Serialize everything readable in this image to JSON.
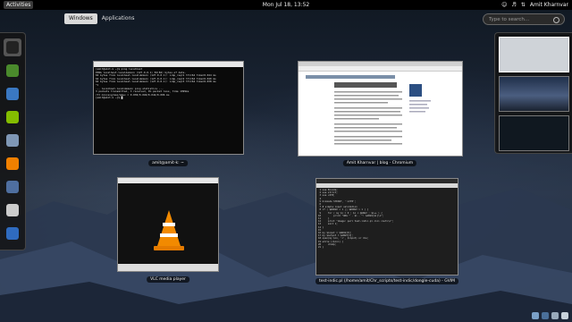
{
  "topbar": {
    "activities": "Activities",
    "clock": "Mon Jul 18, 13:52",
    "user": "Amit Kharnvar"
  },
  "overview": {
    "tabs": [
      "Windows",
      "Applications"
    ],
    "search_placeholder": "Type to search..."
  },
  "dash": {
    "items": [
      {
        "name": "terminal",
        "color": "#222222"
      },
      {
        "name": "gvim",
        "color": "#4a8a2c"
      },
      {
        "name": "chromium",
        "color": "#3a78c2"
      },
      {
        "name": "spotify",
        "color": "#84bd00"
      },
      {
        "name": "text-editor",
        "color": "#7f97b5"
      },
      {
        "name": "vlc",
        "color": "#f08000"
      },
      {
        "name": "system-monitor",
        "color": "#4f6fa0"
      },
      {
        "name": "document",
        "color": "#cccccc"
      },
      {
        "name": "app-grid",
        "color": "#2f6bbf"
      }
    ]
  },
  "windows": {
    "terminal": {
      "caption": "amit@amit-k: ~",
      "lines": [
        "[amit@amit-k ~]$ ping localhost",
        "PING localhost.localdomain (127.0.0.1) 56(84) bytes of data.",
        "64 bytes from localhost.localdomain (127.0.0.1): icmp_req=1 ttl=64 time=0.044 ms",
        "64 bytes from localhost.localdomain (127.0.0.1): icmp_req=2 ttl=64 time=0.040 ms",
        "64 bytes from localhost.localdomain (127.0.0.1): icmp_req=3 ttl=64 time=0.038 ms",
        "^C",
        "--- localhost.localdomain ping statistics ---",
        "3 packets transmitted, 3 received, 0% packet loss, time 1999ms",
        "rtt min/avg/max/mdev = 0.038/0.040/0.044/0.006 ms",
        "[amit@amit-k ~]$ █"
      ]
    },
    "chromium": {
      "caption": "Amit Kharnvar | blog - Chromium"
    },
    "vlc": {
      "caption": "VLC media player"
    },
    "gvim": {
      "caption": "test-indic.pl (/home/amit/Chr_scripts/test-indic/dongle-cuda) - GVIM",
      "lines": [
        " 1 use Encode;",
        " 2 use strict;",
        " 3 use utf8;",
        " 4 ",
        " 5 binmode STDOUT, ':utf8';",
        " 6 ",
        " 7 # simple input validation",
        " 8 if ( $#ARGV < 1 || $#ARGV > 1 ) {",
        " 9     for ( my $i = 0 ; $i < @ARGV ; $i++ ) {",
        "10         print \"ARG \" . $i . \": $ARGV[$i]\\n\";",
        "11     }",
        "12     print \"Usage: perl test-indic.pl <in> <out>\\n\";",
        "13     exit 1;",
        "14 }",
        "15 ",
        "16 my $input = $ARGV[0];",
        "17 my $output = $ARGV[1];",
        "18 open(my $in, '<', $input) or die;",
        "19 while (<$in>) {",
        "20     chomp;",
        "21 }"
      ]
    }
  }
}
